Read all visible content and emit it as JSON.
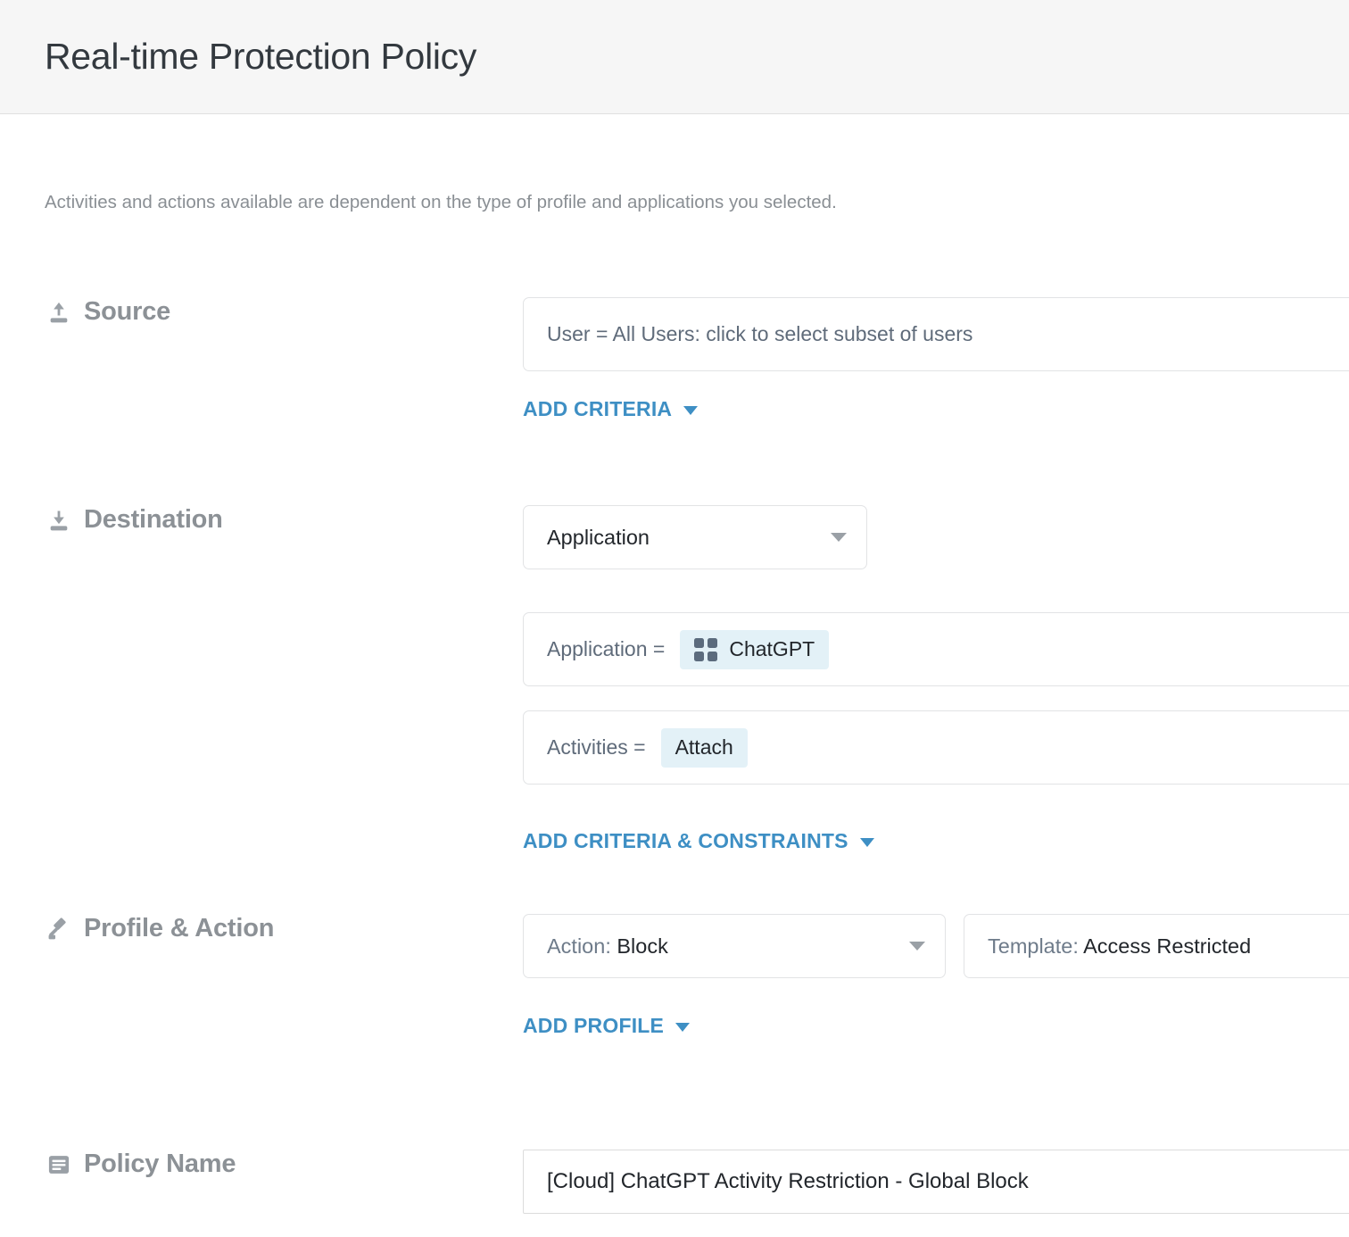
{
  "header": {
    "title": "Real-time Protection Policy"
  },
  "intro": {
    "text": "Activities and actions available are dependent on the type of profile and applications you selected."
  },
  "source": {
    "label": "Source",
    "icon": "upload-icon",
    "criteria_text": "User = All Users: click to select subset of users",
    "add_criteria_label": "ADD CRITERIA"
  },
  "destination": {
    "label": "Destination",
    "icon": "download-icon",
    "type_select": {
      "value": "Application"
    },
    "criteria": [
      {
        "key": "Application =",
        "chip": "ChatGPT",
        "chip_icon": "app-grid-icon"
      },
      {
        "key": "Activities =",
        "chip": "Attach",
        "chip_icon": ""
      }
    ],
    "add_criteria_label": "ADD CRITERIA & CONSTRAINTS"
  },
  "profile_action": {
    "label": "Profile & Action",
    "icon": "gavel-icon",
    "action_select": {
      "prefix": "Action:",
      "value": "Block"
    },
    "template_select": {
      "prefix": "Template:",
      "value": "Access Restricted"
    },
    "add_profile_label": "ADD PROFILE"
  },
  "policy_name": {
    "label": "Policy Name",
    "icon": "document-icon",
    "value": "[Cloud] ChatGPT Activity Restriction - Global Block",
    "placeholder": "Policy Name"
  },
  "colors": {
    "accent_link": "#3e8fc4",
    "chip_background": "#e3f1f7",
    "label_gray": "#8c9196",
    "header_background": "#f6f6f6",
    "border": "#e2e3e5"
  }
}
